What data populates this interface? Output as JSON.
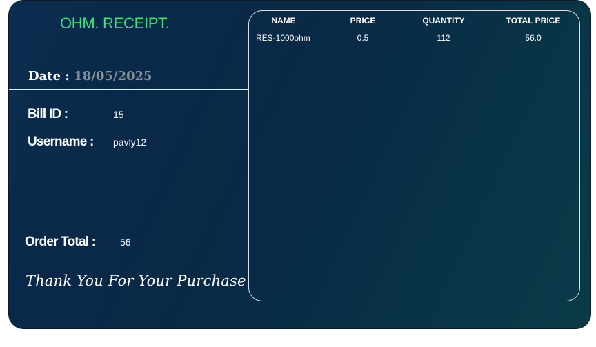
{
  "receipt": {
    "title": "OHM. RECEIPT.",
    "date_label": "Date : ",
    "date_value": "18/05/2025",
    "bill_id_label": "Bill ID :",
    "bill_id_value": "15",
    "username_label": "Username :",
    "username_value": "pavly12",
    "order_total_label": "Order Total :",
    "order_total_value": "56",
    "thanks": "Thank You For Your Purchase"
  },
  "table": {
    "columns": [
      "NAME",
      "PRICE",
      "QUANTITY",
      "TOTAL PRICE"
    ],
    "rows": [
      [
        "RES-1000ohm",
        "0.5",
        "112",
        "56.0"
      ]
    ]
  },
  "colors": {
    "title": "#3ce37a",
    "date_value": "#8a8f96",
    "background_start": "#0b2d4f",
    "background_end": "#0a3a48"
  }
}
